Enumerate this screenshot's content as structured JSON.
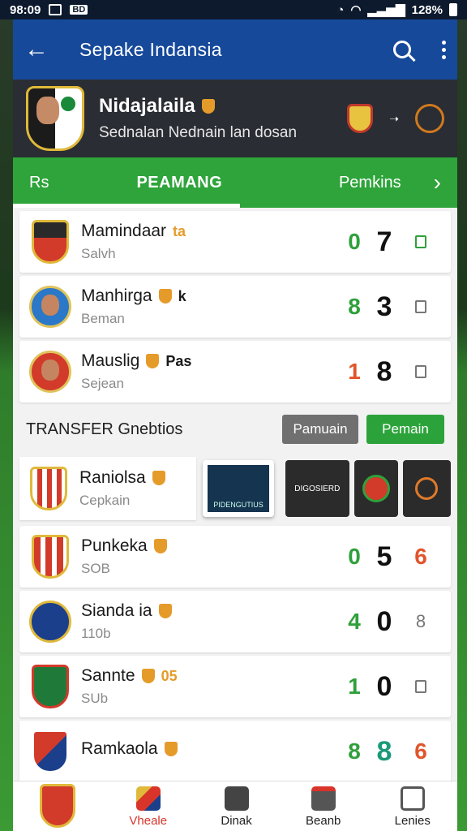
{
  "status_bar": {
    "time": "98:09",
    "label_badge": "BD",
    "battery": "128%"
  },
  "app_bar": {
    "title": "Sepake Indansia"
  },
  "team_header": {
    "name": "Nidajalaila",
    "subtitle": "Sednalan Nednain lan dosan"
  },
  "tabs": {
    "first": "Rs",
    "active": "PEAMANG",
    "third": "Pemkins"
  },
  "players": [
    {
      "name": "Mamindaar",
      "badge": "ta",
      "sub": "Salvh",
      "score_a": "0",
      "score_b": "7",
      "colors": {
        "a": "#2fa03b"
      }
    },
    {
      "name": "Manhirga",
      "badge": "k",
      "sub": "Beman",
      "score_a": "8",
      "score_b": "3",
      "colors": {
        "a": "#2fa03b"
      }
    },
    {
      "name": "Mauslig",
      "badge": "Pas",
      "sub": "Sejean",
      "score_a": "1",
      "score_b": "8",
      "colors": {
        "a": "#e0552b"
      }
    }
  ],
  "transfer_section": {
    "title": "TRANSFER Gnebtios",
    "btn_gray": "Pamuain",
    "btn_green": "Pemain"
  },
  "transfer_card": {
    "name": "Raniolsa",
    "sub": "Cepkain",
    "thumb1_caption": "PIDENGUTIUS",
    "thumb2_caption": "DIGOSIERD"
  },
  "clubs": [
    {
      "name": "Punkeka",
      "badge": "",
      "sub": "SOB",
      "score_a": "0",
      "score_b": "5",
      "score_c": "6",
      "color_a": "#2fa03b",
      "color_c": "#e0552b"
    },
    {
      "name": "Sianda  ia",
      "badge": "",
      "sub": "110b",
      "score_a": "4",
      "score_b": "0",
      "score_c": "8",
      "color_a": "#2fa03b",
      "color_c": "#777"
    },
    {
      "name": "Sannte",
      "badge": "05",
      "sub": "SUb",
      "score_a": "1",
      "score_b": "0",
      "score_c": "",
      "color_a": "#2fa03b",
      "color_c": "#777"
    },
    {
      "name": "Ramkaola",
      "badge": "",
      "sub": "",
      "score_a": "8",
      "score_b": "8",
      "score_c": "6",
      "color_a": "#2fa03b",
      "color_c": "#e0552b"
    }
  ],
  "nav": {
    "item1": "",
    "item2": "Vheale",
    "item3": "Dinak",
    "item4": "Beanb",
    "item5": "Lenies"
  }
}
